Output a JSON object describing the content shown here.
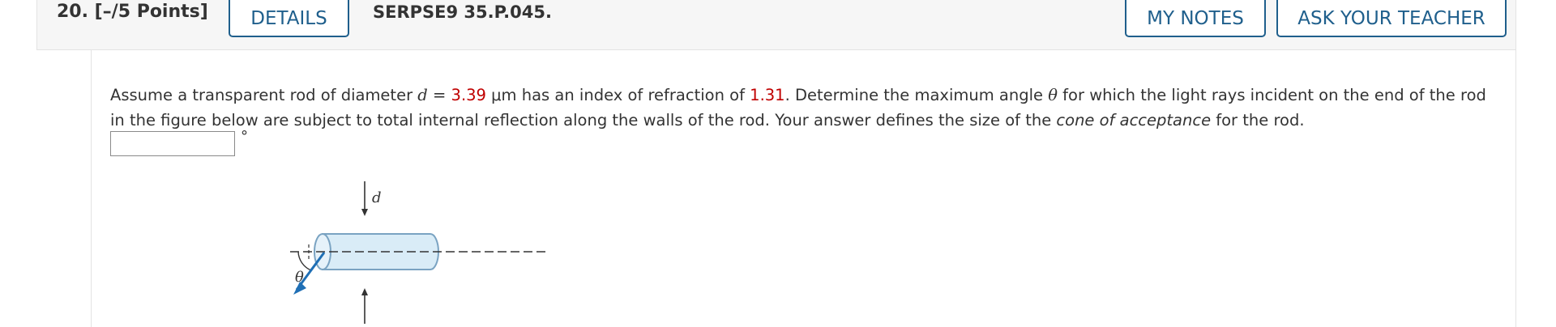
{
  "header": {
    "question_number": "20. [–/5 Points]",
    "details_label": "DETAILS",
    "problem_code": "SERPSE9 35.P.045.",
    "my_notes_label": "MY NOTES",
    "ask_teacher_label": "ASK YOUR TEACHER"
  },
  "question": {
    "text_1": "Assume a transparent rod of diameter ",
    "var_d": "d",
    "eq": " = ",
    "diameter_value": "3.39",
    "text_2": " μm has an index of refraction of ",
    "index_value": "1.31",
    "text_3": ". Determine the maximum angle ",
    "var_theta": "θ",
    "text_4": " for which the light rays incident on the end of the rod in the figure below are subject to total internal reflection along the walls of the rod. Your answer defines the size of the ",
    "emph": "cone of acceptance",
    "text_5": " for the rod."
  },
  "answer": {
    "value": "",
    "unit": "°"
  },
  "figure": {
    "label_d": "d",
    "label_theta": "θ"
  },
  "colors": {
    "accent": "#1f5f8c",
    "given_value": "#c00000",
    "rod_fill": "#d9ecf7",
    "ray": "#1f6fb5"
  }
}
